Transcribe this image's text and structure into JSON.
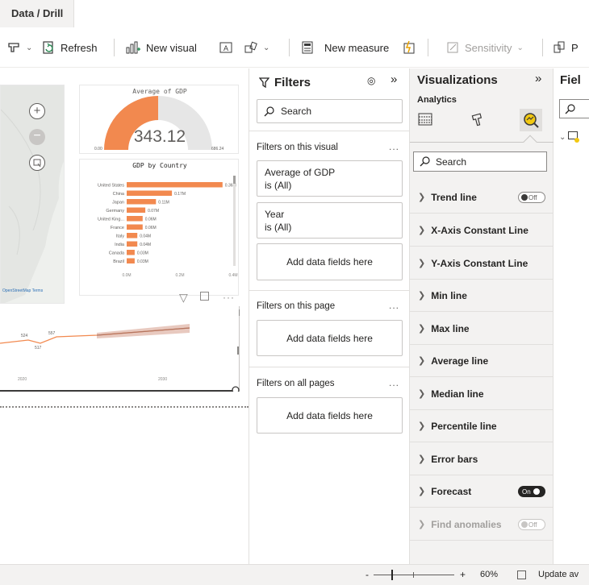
{
  "tab": {
    "label": "Data / Drill"
  },
  "ribbon": {
    "refresh": "Refresh",
    "new_visual": "New visual",
    "new_measure": "New measure",
    "sensitivity": "Sensitivity",
    "publish_partial": "P"
  },
  "gauge": {
    "title": "Average of GDP",
    "value": "343.12",
    "min": "0.00",
    "max": "686.24"
  },
  "map": {
    "attribution": "OpenStreetMap  Terms"
  },
  "bar_chart_title": "GDP by Country",
  "chart_data": {
    "type": "bar",
    "title": "GDP by Country",
    "categories": [
      "United States",
      "China",
      "Japan",
      "Germany",
      "United King...",
      "France",
      "Italy",
      "India",
      "Canada",
      "Brazil"
    ],
    "values": [
      0.36,
      0.17,
      0.11,
      0.07,
      0.06,
      0.06,
      0.04,
      0.04,
      0.03,
      0.03
    ],
    "data_labels": [
      "0.36M",
      "0.17M",
      "0.11M",
      "0.07M",
      "0.06M",
      "0.06M",
      "0.04M",
      "0.04M",
      "0.03M",
      "0.03M"
    ],
    "x_ticks": [
      "0.0M",
      "0.2M",
      "0.4M"
    ],
    "xlim": [
      0,
      0.4
    ],
    "color": "#f2894f"
  },
  "line_chart": {
    "labels": [
      "524",
      "557",
      "517"
    ],
    "x_ticks": [
      "2020",
      "2030"
    ]
  },
  "filters": {
    "title": "Filters",
    "search_placeholder": "Search",
    "on_visual": "Filters on this visual",
    "card1_name": "Average of GDP",
    "card1_state": "is (All)",
    "card2_name": "Year",
    "card2_state": "is (All)",
    "add_fields": "Add data fields here",
    "on_page": "Filters on this page",
    "on_all": "Filters on all pages"
  },
  "viz": {
    "title": "Visualizations",
    "analytics": "Analytics",
    "search_placeholder": "Search",
    "rows": [
      {
        "label": "Trend line",
        "toggle": "Off"
      },
      {
        "label": "X-Axis Constant Line"
      },
      {
        "label": "Y-Axis Constant Line"
      },
      {
        "label": "Min line"
      },
      {
        "label": "Max line"
      },
      {
        "label": "Average line"
      },
      {
        "label": "Median line"
      },
      {
        "label": "Percentile line"
      },
      {
        "label": "Error bars"
      },
      {
        "label": "Forecast",
        "toggle": "On"
      },
      {
        "label": "Find anomalies",
        "toggle": "Off"
      }
    ]
  },
  "fields": {
    "title_partial": "Fiel"
  },
  "status": {
    "zoom_minus": "-",
    "zoom_plus": "+",
    "zoom": "60%",
    "update": "Update av"
  }
}
